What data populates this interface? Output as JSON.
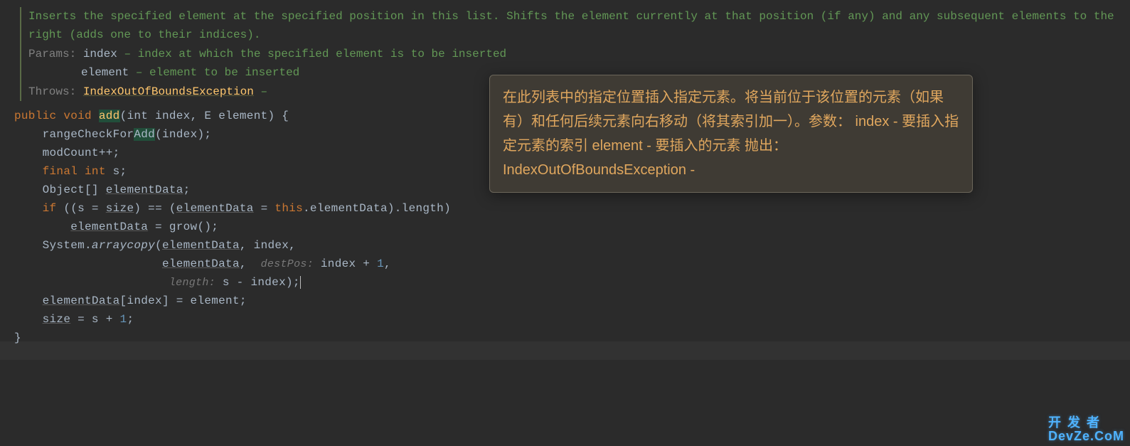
{
  "javadoc": {
    "description": "Inserts the specified element at the specified position in this list. Shifts the element currently at that position (if any) and any subsequent elements to the right (adds one to their indices).",
    "params_label": "Params:",
    "params": [
      {
        "name": "index",
        "desc": "– index at which the specified element is to be inserted"
      },
      {
        "name": "element",
        "desc": "– element to be inserted"
      }
    ],
    "throws_label": "Throws:",
    "throws_exception": "IndexOutOfBoundsException",
    "throws_rest": "–"
  },
  "tooltip": {
    "text": "在此列表中的指定位置插入指定元素。将当前位于该位置的元素（如果有）和任何后续元素向右移动（将其索引加一）。参数： index - 要插入指定元素的索引 element - 要插入的元素 抛出：IndexOutOfBoundsException -"
  },
  "code": {
    "kw_public": "public",
    "kw_void": "void",
    "method_name": "add",
    "sig_rest_pre_E": "(int index, ",
    "type_E": "E",
    "sig_rest_post_E": " element) {",
    "l2_call": "rangeCheckFor",
    "l2_call_hl": "Add",
    "l2_rest": "(index);",
    "l3": "modCount++;",
    "l4_final": "final",
    "l4_int": "int",
    "l4_rest": " s;",
    "l5": "Object[] ",
    "l5_field": "elementData",
    "l5_end": ";",
    "l6_pre": "if ((s = ",
    "l6_size": "size",
    "l6_mid": ") == (",
    "l6_ed": "elementData",
    "l6_eq": " = ",
    "l6_this": "this",
    "l6_dot_ed": ".elementData",
    "l6_rest": ").length)",
    "l7_field": "elementData",
    "l7_rest": " = grow();",
    "l8_pre": "System.",
    "l8_call": "arraycopy",
    "l8_open": "(",
    "l8_arg1": "elementData",
    "l8_comma1": ", index,",
    "l9_arg": "elementData",
    "l9_comma": ",",
    "l9_hint": "destPos:",
    "l9_rest": " index + ",
    "l9_num": "1",
    "l9_end": ",",
    "l10_hint": "length:",
    "l10_rest": " s - index);",
    "l11_field": "elementData",
    "l11_rest": "[index] = element;",
    "l12_pre": "size",
    "l12_mid": " = s + ",
    "l12_num": "1",
    "l12_end": ";",
    "l13": "}"
  },
  "watermark": {
    "row1": "开 发 者",
    "row2": "DevZe.CoM"
  }
}
